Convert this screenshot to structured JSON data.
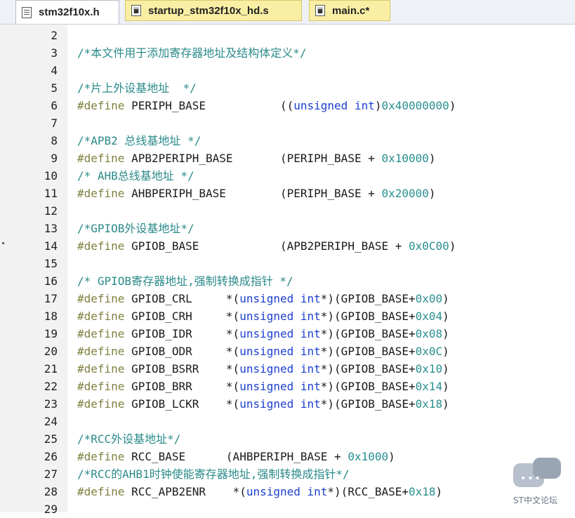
{
  "tabs": [
    {
      "label": "stm32f10x.h",
      "active": true
    },
    {
      "label": "startup_stm32f10x_hd.s",
      "active": false
    },
    {
      "label": "main.c*",
      "active": false
    }
  ],
  "colors": {
    "comment": "#2b8a8a",
    "preprocessor": "#808040",
    "keyword": "#1b3fd0",
    "number": "#2a8f90",
    "text": "#1a1a1a"
  },
  "watermark": {
    "text": "ST中文论坛"
  },
  "lines": [
    {
      "num": "2",
      "tokens": []
    },
    {
      "num": "3",
      "tokens": [
        {
          "t": "comment",
          "v": "/*本文件用于添加寄存器地址及结构体定义*/"
        }
      ]
    },
    {
      "num": "4",
      "tokens": []
    },
    {
      "num": "5",
      "tokens": [
        {
          "t": "comment",
          "v": "/*片上外设基地址  */"
        }
      ]
    },
    {
      "num": "6",
      "tokens": [
        {
          "t": "pp",
          "v": "#define "
        },
        {
          "t": "id",
          "v": "PERIPH_BASE           "
        },
        {
          "t": "op",
          "v": "(("
        },
        {
          "t": "kw",
          "v": "unsigned int"
        },
        {
          "t": "op",
          "v": ")"
        },
        {
          "t": "num",
          "v": "0x40000000"
        },
        {
          "t": "op",
          "v": ")"
        }
      ]
    },
    {
      "num": "7",
      "tokens": []
    },
    {
      "num": "8",
      "tokens": [
        {
          "t": "comment",
          "v": "/*APB2 总线基地址 */"
        }
      ]
    },
    {
      "num": "9",
      "tokens": [
        {
          "t": "pp",
          "v": "#define "
        },
        {
          "t": "id",
          "v": "APB2PERIPH_BASE       "
        },
        {
          "t": "op",
          "v": "(PERIPH_BASE + "
        },
        {
          "t": "num",
          "v": "0x10000"
        },
        {
          "t": "op",
          "v": ")"
        }
      ]
    },
    {
      "num": "10",
      "tokens": [
        {
          "t": "comment",
          "v": "/* AHB总线基地址 */"
        }
      ]
    },
    {
      "num": "11",
      "tokens": [
        {
          "t": "pp",
          "v": "#define "
        },
        {
          "t": "id",
          "v": "AHBPERIPH_BASE        "
        },
        {
          "t": "op",
          "v": "(PERIPH_BASE + "
        },
        {
          "t": "num",
          "v": "0x20000"
        },
        {
          "t": "op",
          "v": ")"
        }
      ]
    },
    {
      "num": "12",
      "tokens": []
    },
    {
      "num": "13",
      "tokens": [
        {
          "t": "comment",
          "v": "/*GPIOB外设基地址*/"
        }
      ]
    },
    {
      "num": "14",
      "tokens": [
        {
          "t": "pp",
          "v": "#define "
        },
        {
          "t": "id",
          "v": "GPIOB_BASE            "
        },
        {
          "t": "op",
          "v": "(APB2PERIPH_BASE + "
        },
        {
          "t": "num",
          "v": "0x0C00"
        },
        {
          "t": "op",
          "v": ")"
        }
      ]
    },
    {
      "num": "15",
      "tokens": []
    },
    {
      "num": "16",
      "tokens": [
        {
          "t": "comment",
          "v": "/* GPIOB寄存器地址,强制转换成指针 */"
        }
      ]
    },
    {
      "num": "17",
      "tokens": [
        {
          "t": "pp",
          "v": "#define "
        },
        {
          "t": "id",
          "v": "GPIOB_CRL     "
        },
        {
          "t": "op",
          "v": "*("
        },
        {
          "t": "kw",
          "v": "unsigned int"
        },
        {
          "t": "op",
          "v": "*)(GPIOB_BASE+"
        },
        {
          "t": "num",
          "v": "0x00"
        },
        {
          "t": "op",
          "v": ")"
        }
      ]
    },
    {
      "num": "18",
      "tokens": [
        {
          "t": "pp",
          "v": "#define "
        },
        {
          "t": "id",
          "v": "GPIOB_CRH     "
        },
        {
          "t": "op",
          "v": "*("
        },
        {
          "t": "kw",
          "v": "unsigned int"
        },
        {
          "t": "op",
          "v": "*)(GPIOB_BASE+"
        },
        {
          "t": "num",
          "v": "0x04"
        },
        {
          "t": "op",
          "v": ")"
        }
      ]
    },
    {
      "num": "19",
      "tokens": [
        {
          "t": "pp",
          "v": "#define "
        },
        {
          "t": "id",
          "v": "GPIOB_IDR     "
        },
        {
          "t": "op",
          "v": "*("
        },
        {
          "t": "kw",
          "v": "unsigned int"
        },
        {
          "t": "op",
          "v": "*)(GPIOB_BASE+"
        },
        {
          "t": "num",
          "v": "0x08"
        },
        {
          "t": "op",
          "v": ")"
        }
      ]
    },
    {
      "num": "20",
      "tokens": [
        {
          "t": "pp",
          "v": "#define "
        },
        {
          "t": "id",
          "v": "GPIOB_ODR     "
        },
        {
          "t": "op",
          "v": "*("
        },
        {
          "t": "kw",
          "v": "unsigned int"
        },
        {
          "t": "op",
          "v": "*)(GPIOB_BASE+"
        },
        {
          "t": "num",
          "v": "0x0C"
        },
        {
          "t": "op",
          "v": ")"
        }
      ]
    },
    {
      "num": "21",
      "tokens": [
        {
          "t": "pp",
          "v": "#define "
        },
        {
          "t": "id",
          "v": "GPIOB_BSRR    "
        },
        {
          "t": "op",
          "v": "*("
        },
        {
          "t": "kw",
          "v": "unsigned int"
        },
        {
          "t": "op",
          "v": "*)(GPIOB_BASE+"
        },
        {
          "t": "num",
          "v": "0x10"
        },
        {
          "t": "op",
          "v": ")"
        }
      ]
    },
    {
      "num": "22",
      "tokens": [
        {
          "t": "pp",
          "v": "#define "
        },
        {
          "t": "id",
          "v": "GPIOB_BRR     "
        },
        {
          "t": "op",
          "v": "*("
        },
        {
          "t": "kw",
          "v": "unsigned int"
        },
        {
          "t": "op",
          "v": "*)(GPIOB_BASE+"
        },
        {
          "t": "num",
          "v": "0x14"
        },
        {
          "t": "op",
          "v": ")"
        }
      ]
    },
    {
      "num": "23",
      "tokens": [
        {
          "t": "pp",
          "v": "#define "
        },
        {
          "t": "id",
          "v": "GPIOB_LCKR    "
        },
        {
          "t": "op",
          "v": "*("
        },
        {
          "t": "kw",
          "v": "unsigned int"
        },
        {
          "t": "op",
          "v": "*)(GPIOB_BASE+"
        },
        {
          "t": "num",
          "v": "0x18"
        },
        {
          "t": "op",
          "v": ")"
        }
      ]
    },
    {
      "num": "24",
      "tokens": []
    },
    {
      "num": "25",
      "tokens": [
        {
          "t": "comment",
          "v": "/*RCC外设基地址*/"
        }
      ]
    },
    {
      "num": "26",
      "tokens": [
        {
          "t": "pp",
          "v": "#define "
        },
        {
          "t": "id",
          "v": "RCC_BASE      "
        },
        {
          "t": "op",
          "v": "(AHBPERIPH_BASE + "
        },
        {
          "t": "num",
          "v": "0x1000"
        },
        {
          "t": "op",
          "v": ")"
        }
      ]
    },
    {
      "num": "27",
      "tokens": [
        {
          "t": "comment",
          "v": "/*RCC的AHB1时钟使能寄存器地址,强制转换成指针*/"
        }
      ]
    },
    {
      "num": "28",
      "tokens": [
        {
          "t": "pp",
          "v": "#define "
        },
        {
          "t": "id",
          "v": "RCC_APB2ENR    "
        },
        {
          "t": "op",
          "v": "*("
        },
        {
          "t": "kw",
          "v": "unsigned int"
        },
        {
          "t": "op",
          "v": "*)(RCC_BASE+"
        },
        {
          "t": "num",
          "v": "0x18"
        },
        {
          "t": "op",
          "v": ")"
        }
      ]
    },
    {
      "num": "29",
      "tokens": []
    }
  ]
}
